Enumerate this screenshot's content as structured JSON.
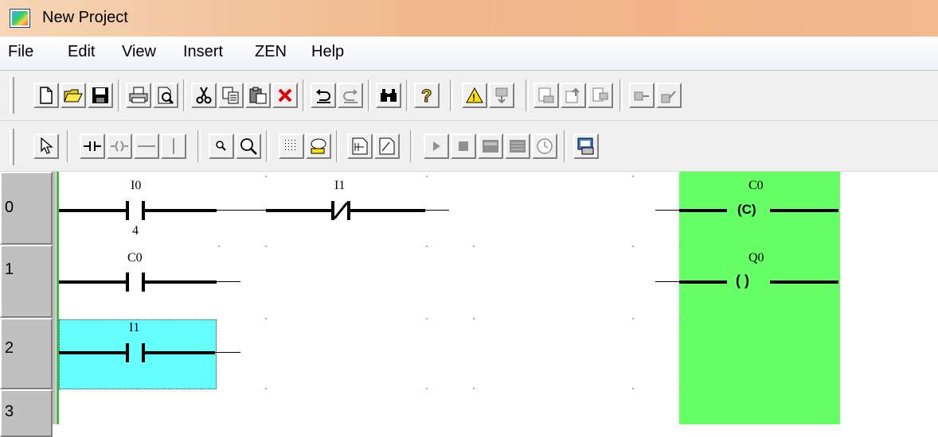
{
  "window": {
    "title": "New Project"
  },
  "menu": [
    "File",
    "Edit",
    "View",
    "Insert",
    "ZEN",
    "Help"
  ],
  "toolbar1": [
    "new-icon",
    "open-icon",
    "save-icon",
    "print-icon",
    "print-preview-icon",
    "cut-icon",
    "copy-icon",
    "paste-icon",
    "delete-icon",
    "undo-icon",
    "redo-icon",
    "find-icon",
    "help-icon",
    "warning-icon",
    "transfer-icon",
    "compile-icon",
    "upload-icon",
    "download-icon",
    "compare-icon",
    "connect-icon",
    "disconnect-icon"
  ],
  "toolbar2": [
    "pointer-icon",
    "contact-icon",
    "coil-icon",
    "horizontal-line-icon",
    "vertical-line-icon",
    "zoom-in-icon",
    "zoom-out-icon",
    "grid-icon",
    "comment-icon",
    "program-view-icon",
    "memory-view-icon",
    "run-icon",
    "stop-icon",
    "monitor-icon",
    "list-icon",
    "clock-icon",
    "settings-icon"
  ],
  "ladder": {
    "rows": [
      "0",
      "1",
      "2",
      "3"
    ],
    "row0": {
      "contact1": "I0",
      "contact2": "I1",
      "coil": "C0",
      "coil_symbol": "(C)"
    },
    "row1": {
      "contact_above_num": "4",
      "contact": "C0",
      "coil": "Q0",
      "coil_symbol": "( )"
    },
    "row2": {
      "contact": "I1"
    }
  },
  "colors": {
    "output_column": "#66ff66",
    "selection": "#66ffff",
    "rail": "#3dbb3d"
  }
}
